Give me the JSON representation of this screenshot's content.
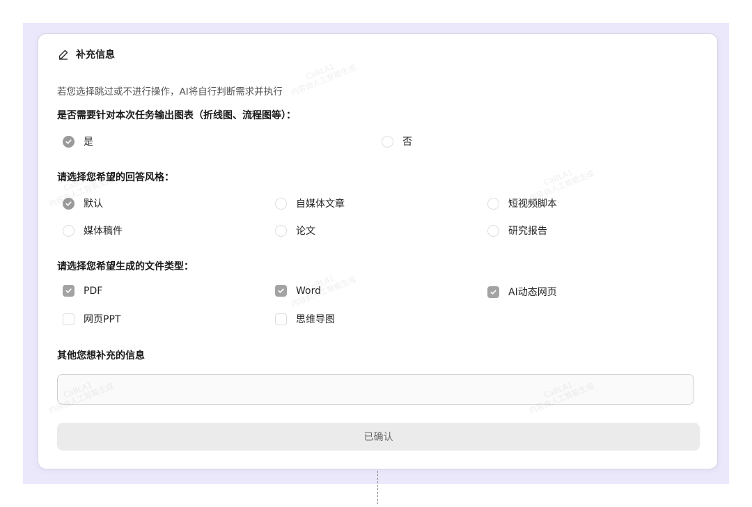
{
  "header": {
    "title": "补充信息",
    "icon": "pencil-icon"
  },
  "hint": "若您选择跳过或不进行操作，AI将自行判断需求并执行",
  "q1": {
    "label": "是否需要针对本次任务输出图表（折线图、流程图等）：",
    "options": [
      {
        "label": "是",
        "selected": true
      },
      {
        "label": "否",
        "selected": false
      }
    ]
  },
  "q2": {
    "label": "请选择您希望的回答风格：",
    "options": [
      {
        "label": "默认",
        "selected": true
      },
      {
        "label": "自媒体文章",
        "selected": false
      },
      {
        "label": "短视频脚本",
        "selected": false
      },
      {
        "label": "媒体稿件",
        "selected": false
      },
      {
        "label": "论文",
        "selected": false
      },
      {
        "label": "研究报告",
        "selected": false
      }
    ]
  },
  "q3": {
    "label": "请选择您希望生成的文件类型：",
    "options": [
      {
        "label": "PDF",
        "checked": true
      },
      {
        "label": "Word",
        "checked": true
      },
      {
        "label": "AI动态网页",
        "checked": true
      },
      {
        "label": "网页PPT",
        "checked": false
      },
      {
        "label": "思维导图",
        "checked": false
      }
    ]
  },
  "extra": {
    "label": "其他您想补充的信息",
    "value": "",
    "placeholder": ""
  },
  "confirm_label": "已确认",
  "watermark": {
    "line1": "CaBLA1",
    "line2": "内容由人工智能生成"
  },
  "colors": {
    "backdrop": "#ece8fb",
    "selected": "#9a9a9a",
    "button_bg": "#ebebeb"
  }
}
